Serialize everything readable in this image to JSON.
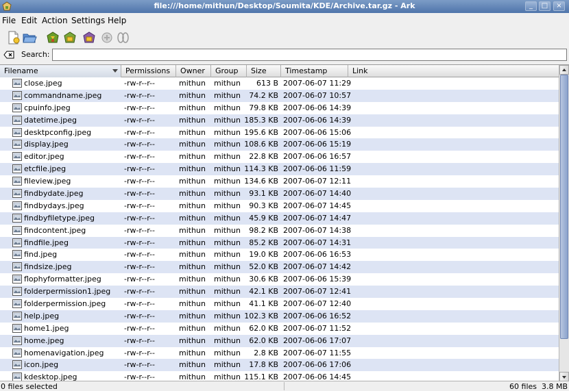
{
  "window": {
    "title": "file:///home/mithun/Desktop/Soumita/KDE/Archive.tar.gz - Ark",
    "accent": "#5a7eb4"
  },
  "menu": {
    "items": [
      {
        "label": "File"
      },
      {
        "label": "Edit"
      },
      {
        "label": "Action"
      },
      {
        "label": "Settings"
      },
      {
        "label": "Help"
      }
    ]
  },
  "toolbar": {
    "icons": [
      "new-archive-icon",
      "open-archive-icon",
      "extract-icon",
      "add-files-icon",
      "add-folder-icon",
      "delete-icon",
      "view-icon"
    ]
  },
  "search": {
    "label": "Search:",
    "value": "",
    "placeholder": ""
  },
  "table": {
    "columns": [
      "Filename",
      "Permissions",
      "Owner",
      "Group",
      "Size",
      "Timestamp",
      "Link"
    ],
    "sorted_column": "Filename",
    "rows": [
      {
        "name": "close.jpeg",
        "perm": "-rw-r--r--",
        "owner": "mithun",
        "group": "mithun",
        "size": "613 B",
        "time": "2007-06-07 11:29"
      },
      {
        "name": "commandname.jpeg",
        "perm": "-rw-r--r--",
        "owner": "mithun",
        "group": "mithun",
        "size": "74.2 KB",
        "time": "2007-06-07 10:57"
      },
      {
        "name": "cpuinfo.jpeg",
        "perm": "-rw-r--r--",
        "owner": "mithun",
        "group": "mithun",
        "size": "79.8 KB",
        "time": "2007-06-06 14:39"
      },
      {
        "name": "datetime.jpeg",
        "perm": "-rw-r--r--",
        "owner": "mithun",
        "group": "mithun",
        "size": "185.3 KB",
        "time": "2007-06-06 14:39"
      },
      {
        "name": "desktpconfig.jpeg",
        "perm": "-rw-r--r--",
        "owner": "mithun",
        "group": "mithun",
        "size": "195.6 KB",
        "time": "2007-06-06 15:06"
      },
      {
        "name": "display.jpeg",
        "perm": "-rw-r--r--",
        "owner": "mithun",
        "group": "mithun",
        "size": "108.6 KB",
        "time": "2007-06-06 15:19"
      },
      {
        "name": "editor.jpeg",
        "perm": "-rw-r--r--",
        "owner": "mithun",
        "group": "mithun",
        "size": "22.8 KB",
        "time": "2007-06-06 16:57"
      },
      {
        "name": "etcfile.jpeg",
        "perm": "-rw-r--r--",
        "owner": "mithun",
        "group": "mithun",
        "size": "114.3 KB",
        "time": "2007-06-06 11:59"
      },
      {
        "name": "fileview.jpeg",
        "perm": "-rw-r--r--",
        "owner": "mithun",
        "group": "mithun",
        "size": "134.6 KB",
        "time": "2007-06-07 12:11"
      },
      {
        "name": "findbydate.jpeg",
        "perm": "-rw-r--r--",
        "owner": "mithun",
        "group": "mithun",
        "size": "93.1 KB",
        "time": "2007-06-07 14:40"
      },
      {
        "name": "findbydays.jpeg",
        "perm": "-rw-r--r--",
        "owner": "mithun",
        "group": "mithun",
        "size": "90.3 KB",
        "time": "2007-06-07 14:45"
      },
      {
        "name": "findbyfiletype.jpeg",
        "perm": "-rw-r--r--",
        "owner": "mithun",
        "group": "mithun",
        "size": "45.9 KB",
        "time": "2007-06-07 14:47"
      },
      {
        "name": "findcontent.jpeg",
        "perm": "-rw-r--r--",
        "owner": "mithun",
        "group": "mithun",
        "size": "98.2 KB",
        "time": "2007-06-07 14:38"
      },
      {
        "name": "findfile.jpeg",
        "perm": "-rw-r--r--",
        "owner": "mithun",
        "group": "mithun",
        "size": "85.2 KB",
        "time": "2007-06-07 14:31"
      },
      {
        "name": "find.jpeg",
        "perm": "-rw-r--r--",
        "owner": "mithun",
        "group": "mithun",
        "size": "19.0 KB",
        "time": "2007-06-06 16:53"
      },
      {
        "name": "findsize.jpeg",
        "perm": "-rw-r--r--",
        "owner": "mithun",
        "group": "mithun",
        "size": "52.0 KB",
        "time": "2007-06-07 14:42"
      },
      {
        "name": "flophyformatter.jpeg",
        "perm": "-rw-r--r--",
        "owner": "mithun",
        "group": "mithun",
        "size": "30.6 KB",
        "time": "2007-06-06 15:39"
      },
      {
        "name": "folderpermission1.jpeg",
        "perm": "-rw-r--r--",
        "owner": "mithun",
        "group": "mithun",
        "size": "42.1 KB",
        "time": "2007-06-07 12:41"
      },
      {
        "name": "folderpermission.jpeg",
        "perm": "-rw-r--r--",
        "owner": "mithun",
        "group": "mithun",
        "size": "41.1 KB",
        "time": "2007-06-07 12:40"
      },
      {
        "name": "help.jpeg",
        "perm": "-rw-r--r--",
        "owner": "mithun",
        "group": "mithun",
        "size": "102.3 KB",
        "time": "2007-06-06 16:52"
      },
      {
        "name": "home1.jpeg",
        "perm": "-rw-r--r--",
        "owner": "mithun",
        "group": "mithun",
        "size": "62.0 KB",
        "time": "2007-06-07 11:52"
      },
      {
        "name": "home.jpeg",
        "perm": "-rw-r--r--",
        "owner": "mithun",
        "group": "mithun",
        "size": "62.0 KB",
        "time": "2007-06-06 17:07"
      },
      {
        "name": "homenavigation.jpeg",
        "perm": "-rw-r--r--",
        "owner": "mithun",
        "group": "mithun",
        "size": "2.8 KB",
        "time": "2007-06-07 11:55"
      },
      {
        "name": "icon.jpeg",
        "perm": "-rw-r--r--",
        "owner": "mithun",
        "group": "mithun",
        "size": "17.8 KB",
        "time": "2007-06-06 17:06"
      },
      {
        "name": "kdesktop.jpeg",
        "perm": "-rw-r--r--",
        "owner": "mithun",
        "group": "mithun",
        "size": "115.1 KB",
        "time": "2007-06-06 14:45"
      }
    ]
  },
  "status": {
    "selection": "0 files selected",
    "count": "60 files",
    "total": "3.8 MB"
  }
}
